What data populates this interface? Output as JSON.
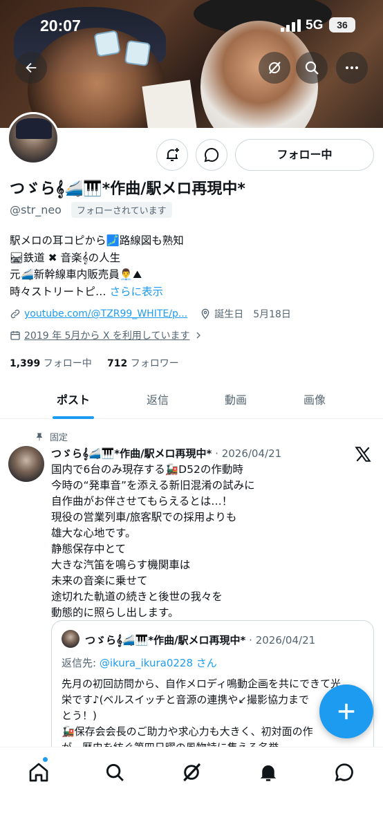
{
  "status_bar": {
    "time": "20:07",
    "network": "5G",
    "battery": "36"
  },
  "profile": {
    "display_name": "つゞら𝄞🚄🎹*作曲/駅メロ再現中*",
    "handle": "@str_neo",
    "follows_you": "フォローされています",
    "follow_button": "フォロー中",
    "bio_lines": [
      "駅メロの耳コピから🗾路線図も熟知",
      "🛤鉄道 ✖ 音楽𝄞の人生",
      "元🚄新幹線車内販売員👨‍💼⛰",
      "時々ストリートピ…"
    ],
    "show_more": "さらに表示",
    "link": "youtube.com/@TZR99_WHITE/p...",
    "birthday": "誕生日　5月18日",
    "joined": "2019 年 5月から X を利用しています",
    "following_count": "1,399",
    "following_label": "フォロー中",
    "followers_count": "712",
    "followers_label": "フォロワー"
  },
  "tabs": [
    {
      "label": "ポスト",
      "active": true
    },
    {
      "label": "返信",
      "active": false
    },
    {
      "label": "動画",
      "active": false
    },
    {
      "label": "画像",
      "active": false
    }
  ],
  "pinned_post": {
    "pinned_label": "固定",
    "author": "つゞら𝄞🚄🎹*作曲/駅メロ再現中*",
    "date": "· 2026/04/21",
    "body_lines": [
      "国内で6台のみ現存する🚂D52の作動時",
      "今時の“発車音”を添える新旧混淆の試みに",
      "自作曲がお伴させてもらえるとは…！",
      "現役の営業列車/旅客駅での採用よりも",
      "雄大な心地です。",
      "静態保存中とて",
      "大きな汽笛を鳴らす機関車は",
      "未来の音楽に乗せて",
      "途切れた軌道の続きと後世の我々を",
      "動態的に照らし出します。"
    ],
    "quote": {
      "author": "つゞら𝄞🚄🎹*作曲/駅メロ再現中*",
      "date": "· 2026/04/21",
      "reply_prefix": "返信先: ",
      "reply_mention": "@ikura_ikura0228 さん",
      "body_lines": [
        "先月の初回訪問から、自作メロディ鳴動企画を共にできて光",
        "栄です♪(ベルスイッチと音源の連携や↙撮影協力まで",
        "とう！)",
        "🚂保存会会長のご助力や求心力も大きく、初対面の作",
        "が、歴史を紡ぐ第四日曜の風物詩に集える名誉…"
      ]
    }
  },
  "colors": {
    "accent": "#1d9bf0",
    "text_primary": "#0f1419",
    "text_secondary": "#536471",
    "border": "#cfd9de"
  },
  "icons": {
    "header": [
      "back-arrow-icon",
      "grok-icon",
      "search-icon",
      "more-icon"
    ],
    "bottom_nav": [
      "home-icon",
      "search-icon",
      "grok-icon",
      "bell-icon",
      "message-icon"
    ]
  }
}
